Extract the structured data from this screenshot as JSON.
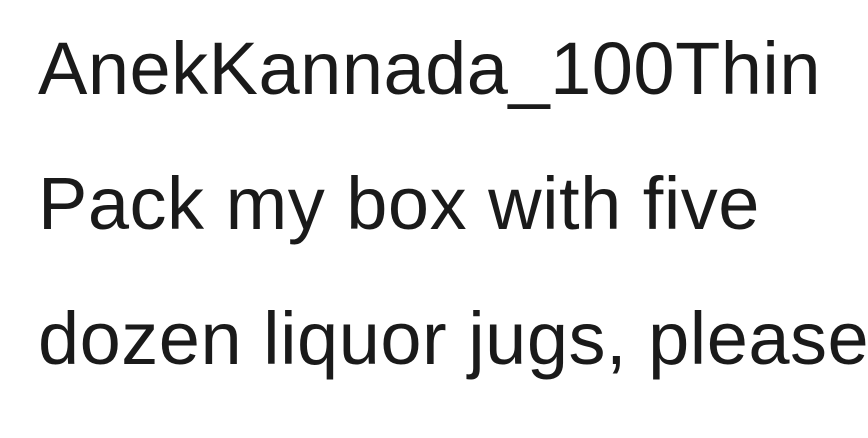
{
  "specimen": {
    "font_name": "AnekKannada_100Thin",
    "sample_line_1": "Pack my box with five",
    "sample_line_2": "dozen liquor jugs, please."
  }
}
